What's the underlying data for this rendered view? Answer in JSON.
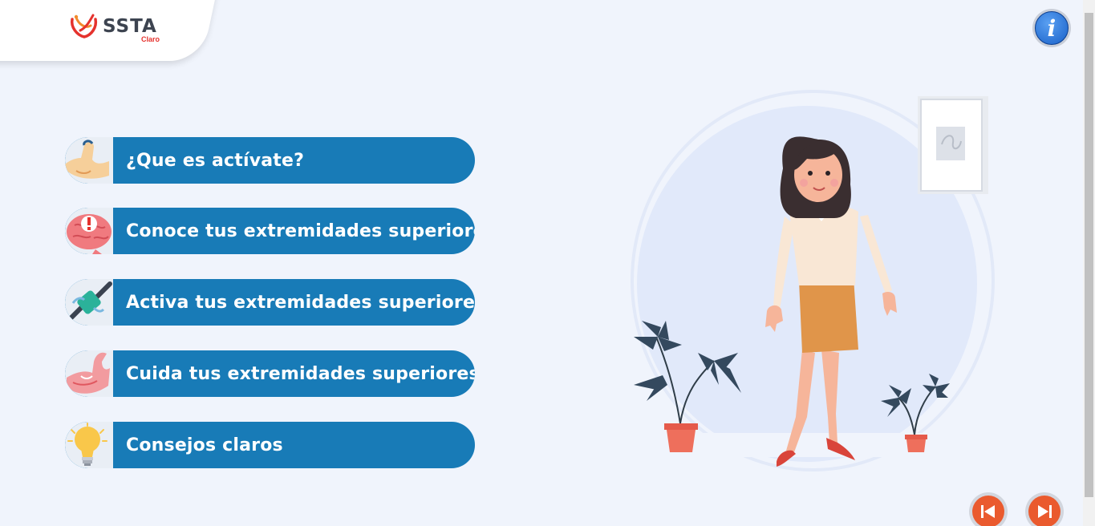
{
  "logo": {
    "name": "SSTA",
    "sub": "Claro"
  },
  "info": {
    "glyph": "i"
  },
  "menu": {
    "items": [
      {
        "label": "¿Que es actívate?",
        "icon": "flexed-arm-icon"
      },
      {
        "label": "Conoce tus extremidades superiores",
        "icon": "brain-alert-icon"
      },
      {
        "label": "Activa tus extremidades superiores",
        "icon": "hand-grip-icon"
      },
      {
        "label": "Cuida tus extremidades superiores",
        "icon": "muscle-arm-icon"
      },
      {
        "label": "Consejos claros",
        "icon": "lightbulb-icon"
      }
    ]
  },
  "nav": {
    "first_icon": "skip-first-icon",
    "next_icon": "skip-next-icon"
  },
  "colors": {
    "button_blue": "#187bb7",
    "nav_orange": "#ea5a2e",
    "background": "#f0f4fc",
    "brand_red": "#e5322d"
  }
}
